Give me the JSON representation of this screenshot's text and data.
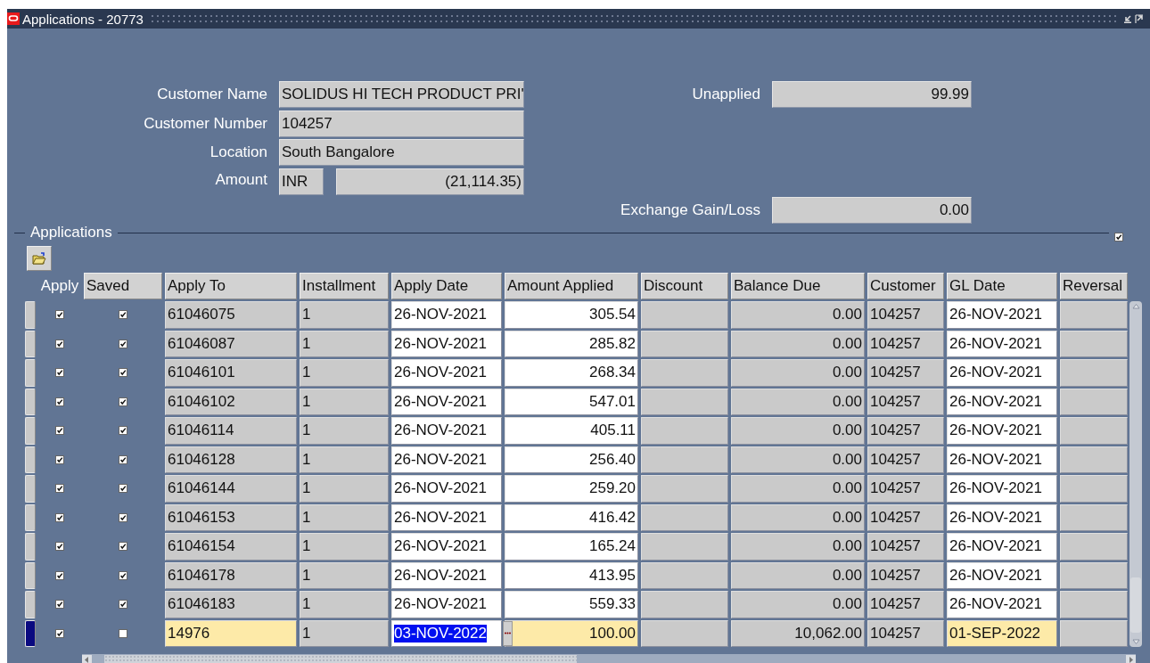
{
  "window": {
    "title": "Applications - 20773"
  },
  "header": {
    "customer_name": {
      "label": "Customer Name",
      "value": "SOLIDUS HI TECH PRODUCT PRI'"
    },
    "customer_number": {
      "label": "Customer Number",
      "value": "104257"
    },
    "location": {
      "label": "Location",
      "value": "South Bangalore"
    },
    "amount": {
      "label": "Amount",
      "currency": "INR",
      "value": "(21,114.35)"
    },
    "unapplied": {
      "label": "Unapplied",
      "value": "99.99"
    },
    "exchange_gain_loss": {
      "label": "Exchange Gain/Loss",
      "value": "0.00"
    }
  },
  "applications": {
    "title": "Applications",
    "show_all_checked": true,
    "columns": [
      {
        "label": "Apply",
        "kind": "check"
      },
      {
        "label": "Saved",
        "kind": "check"
      },
      {
        "label": "Apply To",
        "kind": "field"
      },
      {
        "label": "Installment",
        "kind": "field"
      },
      {
        "label": "Apply Date",
        "kind": "entry"
      },
      {
        "label": "Amount Applied",
        "kind": "entry_number"
      },
      {
        "label": "Discount",
        "kind": "number"
      },
      {
        "label": "Balance Due",
        "kind": "number"
      },
      {
        "label": "Customer",
        "kind": "field"
      },
      {
        "label": "GL Date",
        "kind": "entry"
      },
      {
        "label": "Reversal",
        "kind": "field"
      }
    ],
    "rows": [
      {
        "current": false,
        "apply": true,
        "saved": true,
        "apply_to": "61046075",
        "installment": "1",
        "apply_date": "26-NOV-2021",
        "amount_applied": "305.54",
        "balance_due": "0.00",
        "customer_number": "104257",
        "gl_date": "26-NOV-2021"
      },
      {
        "current": false,
        "apply": true,
        "saved": true,
        "apply_to": "61046087",
        "installment": "1",
        "apply_date": "26-NOV-2021",
        "amount_applied": "285.82",
        "balance_due": "0.00",
        "customer_number": "104257",
        "gl_date": "26-NOV-2021"
      },
      {
        "current": false,
        "apply": true,
        "saved": true,
        "apply_to": "61046101",
        "installment": "1",
        "apply_date": "26-NOV-2021",
        "amount_applied": "268.34",
        "balance_due": "0.00",
        "customer_number": "104257",
        "gl_date": "26-NOV-2021"
      },
      {
        "current": false,
        "apply": true,
        "saved": true,
        "apply_to": "61046102",
        "installment": "1",
        "apply_date": "26-NOV-2021",
        "amount_applied": "547.01",
        "balance_due": "0.00",
        "customer_number": "104257",
        "gl_date": "26-NOV-2021"
      },
      {
        "current": false,
        "apply": true,
        "saved": true,
        "apply_to": "61046114",
        "installment": "1",
        "apply_date": "26-NOV-2021",
        "amount_applied": "405.11",
        "balance_due": "0.00",
        "customer_number": "104257",
        "gl_date": "26-NOV-2021"
      },
      {
        "current": false,
        "apply": true,
        "saved": true,
        "apply_to": "61046128",
        "installment": "1",
        "apply_date": "26-NOV-2021",
        "amount_applied": "256.40",
        "balance_due": "0.00",
        "customer_number": "104257",
        "gl_date": "26-NOV-2021"
      },
      {
        "current": false,
        "apply": true,
        "saved": true,
        "apply_to": "61046144",
        "installment": "1",
        "apply_date": "26-NOV-2021",
        "amount_applied": "259.20",
        "balance_due": "0.00",
        "customer_number": "104257",
        "gl_date": "26-NOV-2021"
      },
      {
        "current": false,
        "apply": true,
        "saved": true,
        "apply_to": "61046153",
        "installment": "1",
        "apply_date": "26-NOV-2021",
        "amount_applied": "416.42",
        "balance_due": "0.00",
        "customer_number": "104257",
        "gl_date": "26-NOV-2021"
      },
      {
        "current": false,
        "apply": true,
        "saved": true,
        "apply_to": "61046154",
        "installment": "1",
        "apply_date": "26-NOV-2021",
        "amount_applied": "165.24",
        "balance_due": "0.00",
        "customer_number": "104257",
        "gl_date": "26-NOV-2021"
      },
      {
        "current": false,
        "apply": true,
        "saved": true,
        "apply_to": "61046178",
        "installment": "1",
        "apply_date": "26-NOV-2021",
        "amount_applied": "413.95",
        "balance_due": "0.00",
        "customer_number": "104257",
        "gl_date": "26-NOV-2021"
      },
      {
        "current": false,
        "apply": true,
        "saved": true,
        "apply_to": "61046183",
        "installment": "1",
        "apply_date": "26-NOV-2021",
        "amount_applied": "559.33",
        "balance_due": "0.00",
        "customer_number": "104257",
        "gl_date": "26-NOV-2021"
      },
      {
        "current": true,
        "apply": true,
        "saved": false,
        "apply_to": "14976",
        "installment": "1",
        "apply_date": "03-NOV-2022",
        "amount_applied": "100.00",
        "balance_due": "10,062.00",
        "customer_number": "104257",
        "gl_date": "01-SEP-2022"
      }
    ]
  }
}
